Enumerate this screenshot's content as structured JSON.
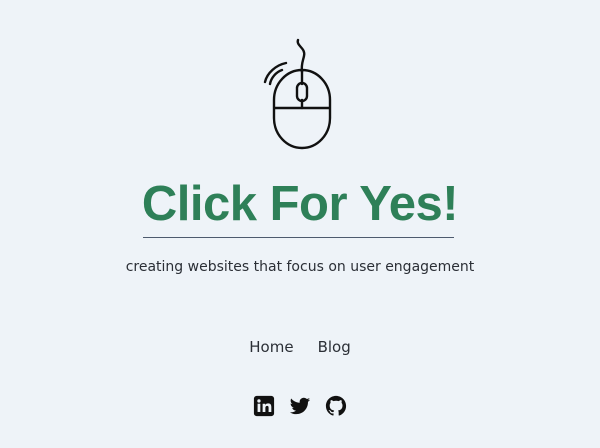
{
  "brand": {
    "logo_icon": "computer-mouse-click-icon",
    "title": "Click For Yes!",
    "tagline": "creating websites that focus on user engagement",
    "accent_color": "#2e8058"
  },
  "nav": {
    "items": [
      {
        "label": "Home"
      },
      {
        "label": "Blog"
      }
    ]
  },
  "social": {
    "icons": [
      "linkedin-icon",
      "twitter-icon",
      "github-icon"
    ]
  }
}
